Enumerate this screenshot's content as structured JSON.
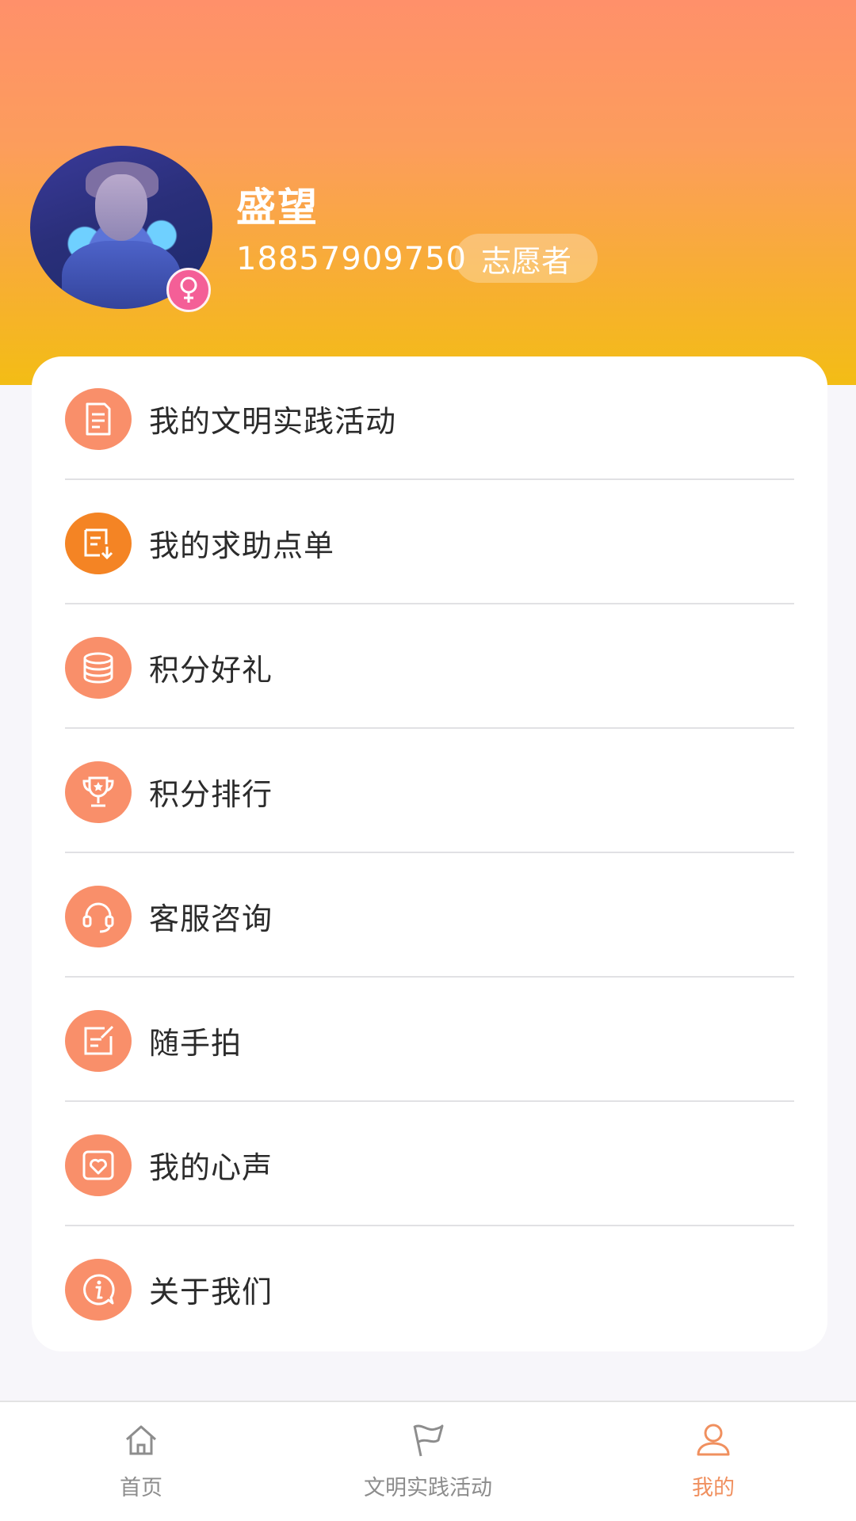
{
  "profile": {
    "name": "盛望",
    "phone": "18857909750",
    "role": "志愿者",
    "gender_icon": "female-icon",
    "gender_color": "#f45f97"
  },
  "menu": [
    {
      "label": "我的文明实践活动",
      "icon": "document-icon"
    },
    {
      "label": "我的求助点单",
      "icon": "order-download-icon"
    },
    {
      "label": "积分好礼",
      "icon": "coin-stack-icon"
    },
    {
      "label": "积分排行",
      "icon": "trophy-icon"
    },
    {
      "label": "客服咨询",
      "icon": "headset-icon"
    },
    {
      "label": "随手拍",
      "icon": "edit-note-icon"
    },
    {
      "label": "我的心声",
      "icon": "heart-icon"
    },
    {
      "label": "关于我们",
      "icon": "info-icon"
    }
  ],
  "tabs": [
    {
      "label": "首页",
      "icon": "home-icon",
      "active": false
    },
    {
      "label": "文明实践活动",
      "icon": "flag-icon",
      "active": false
    },
    {
      "label": "我的",
      "icon": "person-icon",
      "active": true
    }
  ],
  "colors": {
    "accent": "#f98f6a",
    "active_tab": "#f0905f",
    "header_top": "#ff906a",
    "header_bottom": "#f3bd15"
  }
}
